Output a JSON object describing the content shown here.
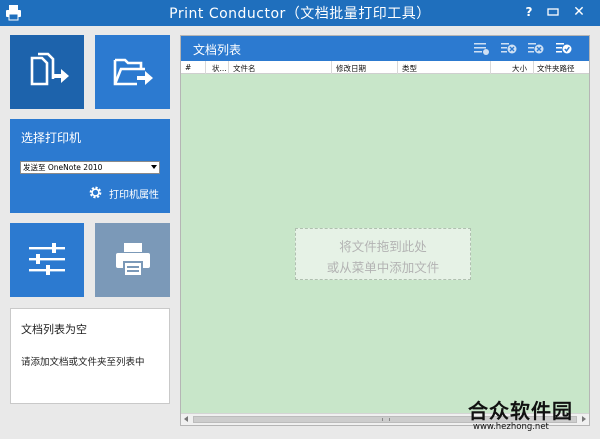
{
  "window": {
    "title": "Print Conductor（文档批量打印工具）",
    "help": "?",
    "minimize": "▭",
    "close": "✕"
  },
  "left": {
    "printer_title": "选择打印机",
    "printer_selected": "发送至 OneNote 2010",
    "printer_properties": "打印机属性",
    "status_title": "文档列表为空",
    "status_text": "请添加文档或文件夹至列表中"
  },
  "doc_list": {
    "title": "文档列表",
    "columns": [
      "#",
      "状...",
      "文件名",
      "修改日期",
      "类型",
      "大小",
      "文件夹路径"
    ],
    "drop_hint_line1": "将文件拖到此处",
    "drop_hint_line2": "或从菜单中添加文件"
  },
  "watermark": {
    "title": "合众软件园",
    "url": "www.hezhong.net"
  },
  "colors": {
    "titlebar": "#1f6fbd",
    "tile_blue": "#2c7ad0",
    "tile_dark": "#1d63ac",
    "tile_disabled": "#7b99b8",
    "list_bg": "#c8e6c9"
  }
}
